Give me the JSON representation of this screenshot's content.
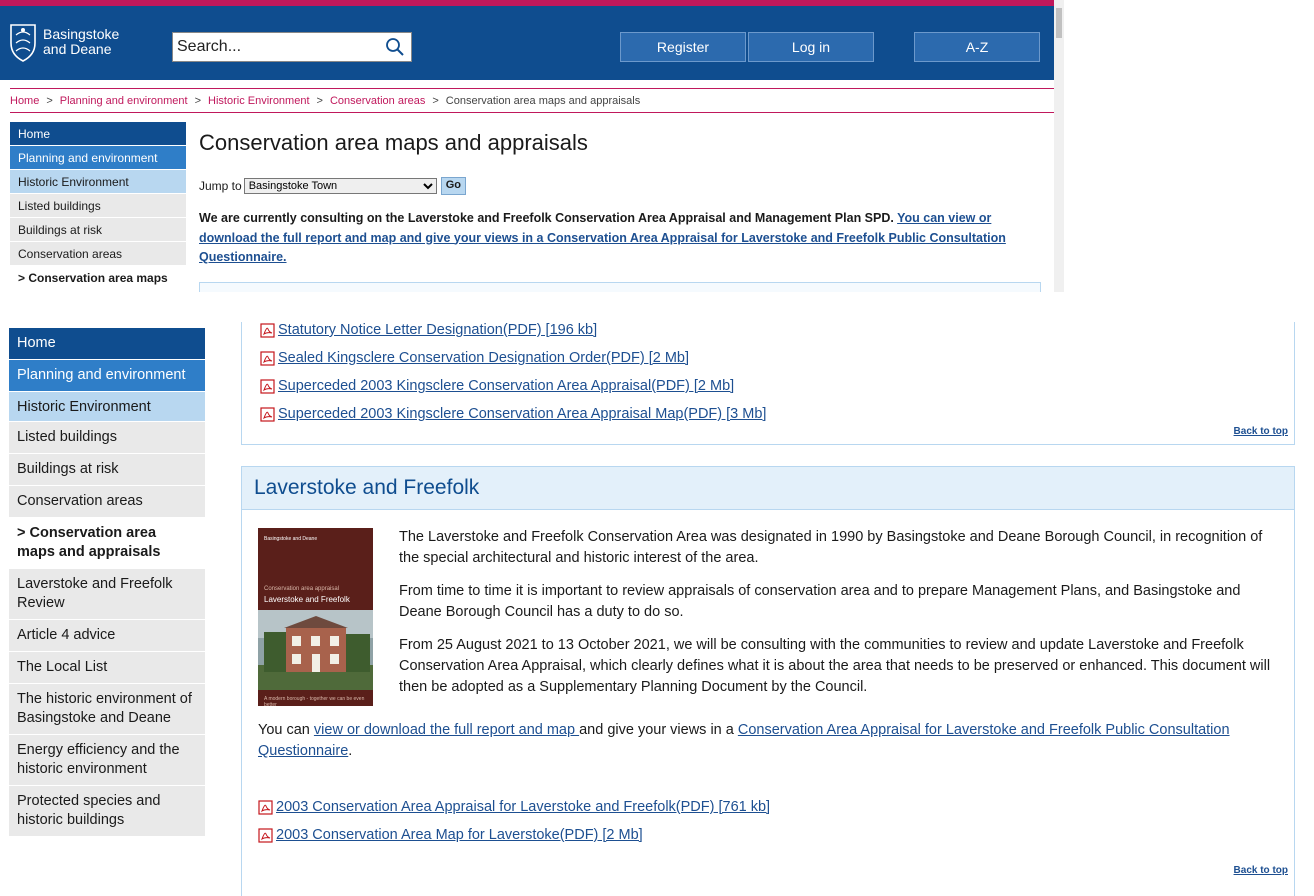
{
  "header": {
    "logo_line1": "Basingstoke",
    "logo_line2": "and Deane",
    "search_placeholder": "Search...",
    "register_label": "Register",
    "login_label": "Log in",
    "az_label": "A-Z"
  },
  "breadcrumb": [
    "Home",
    "Planning and environment",
    "Historic Environment",
    "Conservation areas",
    "Conservation area maps and appraisals"
  ],
  "sidebar_top": {
    "items": [
      "Home",
      "Planning and environment",
      "Historic Environment",
      "Listed buildings",
      "Buildings at risk",
      "Conservation areas",
      "> Conservation area maps"
    ]
  },
  "sidebar": {
    "items": [
      "Home",
      "Planning and environment",
      "Historic Environment",
      "Listed buildings",
      "Buildings at risk",
      "Conservation areas",
      "> Conservation area maps and appraisals",
      "Laverstoke and Freefolk Review",
      "Article 4 advice",
      "The Local List",
      "The historic environment of Basingstoke and Deane",
      "Energy efficiency and the historic environment",
      "Protected species and historic buildings"
    ]
  },
  "page": {
    "title": "Conservation area maps and appraisals",
    "jump_label": "Jump to",
    "jump_selected": "Basingstoke Town",
    "go_label": "Go",
    "consult_text": "We are currently consulting on the Laverstoke and Freefolk Conservation Area Appraisal and Management Plan SPD. ",
    "consult_link": "You can view or download the full report and map and give your views in a Conservation Area Appraisal for Laverstoke and Freefolk Public Consultation Questionnaire."
  },
  "kingsclere_docs": [
    "Statutory Notice Letter Designation(PDF) [196 kb]",
    "Sealed Kingsclere Conservation Designation Order(PDF) [2 Mb]",
    "Superceded 2003 Kingsclere Conservation Area Appraisal(PDF) [2 Mb]",
    "Superceded 2003 Kingsclere Conservation Area Appraisal Map(PDF) [3 Mb]"
  ],
  "back_to_top": "Back to top",
  "laverstoke": {
    "heading": "Laverstoke and Freefolk",
    "cover": {
      "crest_text": "Basingstoke and Deane",
      "subtitle": "Conservation area appraisal",
      "title": "Laverstoke and Freefolk",
      "footer": "A modern borough - together we can be even better"
    },
    "paragraphs": [
      "The Laverstoke and Freefolk Conservation Area was designated in 1990 by Basingstoke and Deane Borough Council, in recognition of the special architectural and historic interest of the area.",
      "From time to time it is important to review appraisals of conservation area and to prepare Management Plans, and Basingstoke and Deane Borough Council has a duty to do so.",
      "From 25 August 2021 to 13 October 2021, we will be consulting with the communities to review and update Laverstoke and Freefolk Conservation Area Appraisal, which clearly defines what it is about the area that needs to be preserved or enhanced. This document will then be adopted as a Supplementary Planning Document by the Council."
    ],
    "youcan_pre": "You can ",
    "youcan_link1": "view or download the full report and map ",
    "youcan_mid": "and give your views in a ",
    "youcan_link2": "Conservation Area Appraisal for Laverstoke and Freefolk Public Consultation Questionnaire",
    "youcan_end": ".",
    "docs": [
      "2003 Conservation Area Appraisal for Laverstoke and Freefolk(PDF) [761 kb]",
      "2003 Conservation Area Map for Laverstoke(PDF) [2 Mb]"
    ]
  },
  "colors": {
    "brand_blue": "#0f4d8f",
    "accent_pink": "#c0185c",
    "link_blue": "#1d4f91",
    "nav_light_blue": "#b8d7f0"
  }
}
